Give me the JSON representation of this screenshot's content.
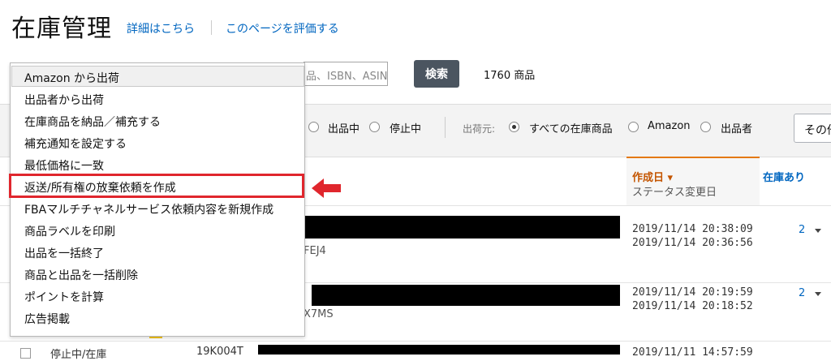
{
  "header": {
    "title": "在庫管理",
    "details_link": "詳細はこちら",
    "rate_link": "このページを評価する"
  },
  "search": {
    "visible_text": "品、ISBN、ASIN",
    "button": "検索",
    "count": "1760 商品"
  },
  "filters": {
    "status_options": [
      "出品中",
      "停止中"
    ],
    "ship_from_label": "出荷元:",
    "ship_from_options": [
      "すべての在庫商品",
      "Amazon",
      "出品者"
    ],
    "ship_from_selected": "すべての在庫商品",
    "other_button": "その他"
  },
  "columns": {
    "created_date": "作成日 ▾",
    "status_changed": "ステータス変更日",
    "in_stock": "在庫あり"
  },
  "rows": [
    {
      "asin_partial": "FEJ4",
      "created": "2019/11/14 20:38:09",
      "changed": "2019/11/14 20:36:56",
      "stock": "2"
    },
    {
      "asin_partial": "X7MS",
      "created": "2019/11/14 20:19:59",
      "changed": "2019/11/14 20:18:52",
      "stock": "2"
    },
    {
      "status": "停止中/在庫",
      "sku_partial": "19K004T",
      "created": "2019/11/11 14:57:59"
    }
  ],
  "dropdown": {
    "selected": "Amazon から出荷",
    "items": [
      "出品者から出荷",
      "在庫商品を納品／補充する",
      "補充通知を設定する",
      "最低価格に一致",
      "返送/所有権の放棄依頼を作成",
      "FBAマルチチャネルサービス依頼内容を新規作成",
      "商品ラベルを印刷",
      "出品を一括終了",
      "商品と出品を一括削除",
      "ポイントを計算",
      "広告掲載"
    ],
    "highlighted_index": 4
  },
  "colors": {
    "accent": "#e0262d",
    "link": "#0066c0",
    "sort_active": "#c45500"
  }
}
